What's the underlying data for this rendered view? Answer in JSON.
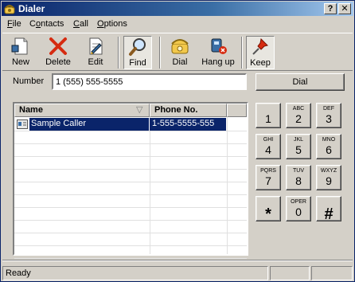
{
  "window": {
    "title": "Dialer",
    "help_button": "?",
    "close_button": "✕"
  },
  "menu": [
    {
      "label_u": "F",
      "label_rest": "ile"
    },
    {
      "label_pre": "C",
      "label_u": "o",
      "label_rest": "ntacts"
    },
    {
      "label_u": "C",
      "label_rest": "all"
    },
    {
      "label_u": "O",
      "label_rest": "ptions"
    }
  ],
  "toolbar": {
    "new_label": "New",
    "delete_label": "Delete",
    "edit_label": "Edit",
    "find_label": "Find",
    "dial_label": "Dial",
    "hangup_label": "Hang up",
    "keep_label": "Keep"
  },
  "number": {
    "label": "Number",
    "value": "1 (555) 555-5555",
    "dial_button": "Dial"
  },
  "contacts": {
    "columns": [
      "Name",
      "Phone No."
    ],
    "sort_indicator": "▽",
    "rows": [
      {
        "name": "Sample Caller",
        "phone": "1-555-5555-555",
        "selected": true
      }
    ]
  },
  "keypad": [
    {
      "sub": "",
      "main": "1"
    },
    {
      "sub": "ABC",
      "main": "2"
    },
    {
      "sub": "DEF",
      "main": "3"
    },
    {
      "sub": "GHI",
      "main": "4"
    },
    {
      "sub": "JKL",
      "main": "5"
    },
    {
      "sub": "MNO",
      "main": "6"
    },
    {
      "sub": "PQRS",
      "main": "7"
    },
    {
      "sub": "TUV",
      "main": "8"
    },
    {
      "sub": "WXYZ",
      "main": "9"
    },
    {
      "sub": "",
      "main": "*"
    },
    {
      "sub": "OPER",
      "main": "0"
    },
    {
      "sub": "",
      "main": "#"
    }
  ],
  "status": {
    "text": "Ready",
    "pane2": "",
    "pane3": ""
  },
  "icons": {
    "app": "phone-icon",
    "new": "new-document-icon",
    "delete": "red-x-icon",
    "edit": "edit-document-icon",
    "find": "magnifier-icon",
    "dial": "telephone-icon",
    "hangup": "hangup-icon",
    "keep": "pushpin-icon",
    "contact": "contact-card-icon"
  }
}
